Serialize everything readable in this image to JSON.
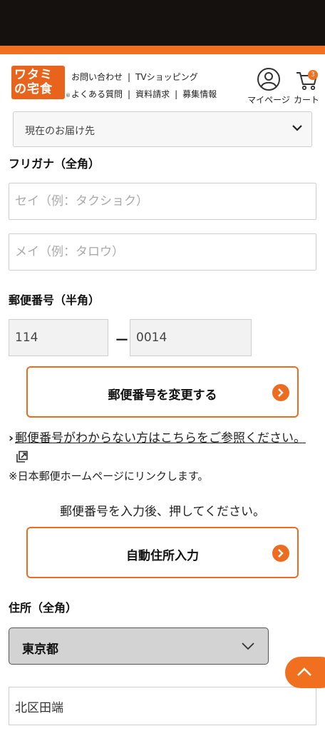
{
  "header": {
    "logo_line1": "ワタミ",
    "logo_line2": "の宅食",
    "logo_mark": "®",
    "links_row1": [
      "お問い合わせ",
      "TVショッピング"
    ],
    "links_row2": [
      "よくある質問",
      "資料請求",
      "募集情報"
    ],
    "separator": "|",
    "mypage_label": "マイページ",
    "cart_label": "カート",
    "cart_count": "3",
    "mypage_icon": "user-circle-icon",
    "cart_icon": "cart-icon"
  },
  "delivery": {
    "label": "現在のお届け先"
  },
  "furigana": {
    "label": "フリガナ（全角）",
    "sei_placeholder": "セイ（例：タクショク）",
    "mei_placeholder": "メイ（例：タロウ）"
  },
  "postal": {
    "label": "郵便番号（半角）",
    "first": "114",
    "dash": "－",
    "second": "0014",
    "change_button": "郵便番号を変更する",
    "help_chevron": "›",
    "help_link": "郵便番号がわからない方はこちらをご参照ください。",
    "note": "※日本郵便ホームページにリンクします。",
    "instruction": "郵便番号を入力後、押してください。",
    "auto_button": "自動住所入力"
  },
  "address": {
    "label": "住所（全角）",
    "prefecture": "東京都",
    "city": "北区田端"
  },
  "colors": {
    "accent": "#f07020",
    "statusbar": "#15110f"
  }
}
